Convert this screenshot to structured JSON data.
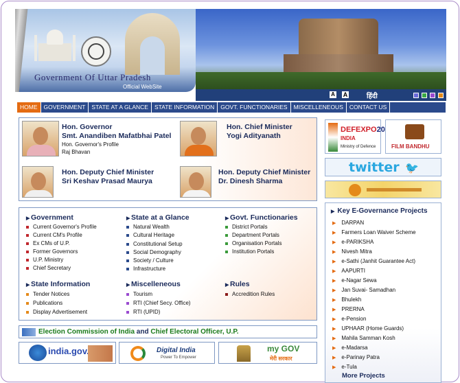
{
  "header": {
    "title": "Government Of Uttar Pradesh",
    "subtitle": "Official WebSite",
    "lang_a_small": "A",
    "lang_a_large": "A",
    "hindi": "हिंदी",
    "theme_colors": [
      "#6a6ad8",
      "#3aa845",
      "#9a4ad0",
      "#e48a1a",
      "#2a5ad0"
    ]
  },
  "nav": {
    "items": [
      "HOME",
      "GOVERNMENT",
      "STATE AT A GLANCE",
      "STATE INFORMATION",
      "GOVT. FUNCTIONARIES",
      "MISCELLENEOUS",
      "CONTACT US"
    ],
    "active": "HOME"
  },
  "officials": {
    "governor": {
      "title": "Hon. Governor",
      "name": "Smt. Anandiben Mafatbhai Patel",
      "link1": "Hon. Governor's Profile",
      "link2": "Raj Bhavan"
    },
    "cm": {
      "title": "Hon. Chief Minister",
      "name": "Yogi Adityanath"
    },
    "dcm1": {
      "title": "Hon. Deputy Chief Minister",
      "name": "Sri Keshav Prasad Maurya"
    },
    "dcm2": {
      "title": "Hon. Deputy Chief Minister",
      "name": "Dr. Dinesh Sharma"
    }
  },
  "sections": {
    "government": {
      "title": "Government",
      "items": [
        "Current Governor's Profile",
        "Current CM's Profile",
        "Ex CMs of U.P.",
        "Former Governors",
        "U.P. Ministry",
        "Chief Secretary"
      ]
    },
    "glance": {
      "title": "State at a Glance",
      "items": [
        "Natural Wealth",
        "Cultural Heritage",
        "Constitutional Setup",
        "Social Demography",
        "Society / Culture",
        "Infrastructure"
      ]
    },
    "functionaries": {
      "title": "Govt. Functionaries",
      "items": [
        "District Portals",
        "Department Portals",
        "Organisation Portals",
        "Institution Portals"
      ]
    },
    "state_info": {
      "title": "State Information",
      "items": [
        "Tender Notices",
        "Publications",
        "Display Advertisement"
      ]
    },
    "misc": {
      "title": "Miscelleneous",
      "items": [
        "Tourism",
        "RTI (Chief Secy. Office)",
        "RTI (UPID)"
      ]
    },
    "rules": {
      "title": "Rules",
      "items": [
        "Accredition Rules"
      ]
    }
  },
  "election": {
    "part1": "Election Commission of India",
    "and": "and",
    "part2": "Chief Electoral Officer, U.P."
  },
  "banners": {
    "india_gov": "india.gov.in",
    "digital_india": "Digital India",
    "digital_india_sub": "Power To Empower",
    "mygov": "my GOV",
    "mygov_hindi": "मेरी सरकार"
  },
  "right": {
    "defexpo": "DEFEXPO",
    "defexpo_year": "20",
    "defexpo_sub": "Ministry of Defence",
    "defexpo_country": "INDIA",
    "film_bandhu": "FILM BANDHU",
    "twitter": "twitter",
    "egov_title": "Key E-Governance Projects",
    "egov_items": [
      "DARPAN",
      "Farmers Loan Waiver Scheme",
      "e-PARIKSHA",
      "Nivesh Mitra",
      "e-Sathi (Janhit Guarantee Act)",
      "AAPURTI",
      "e-Nagar Sewa",
      "Jan Suvai- Samadhan",
      "Bhulekh",
      "PRERNA",
      "e-Pension",
      "UPHAAR (Home Guards)",
      "Mahila Samman Kosh",
      "e-Madarsa",
      "e-Parinay Patra",
      "e-Tula"
    ],
    "more": "More Projects"
  }
}
